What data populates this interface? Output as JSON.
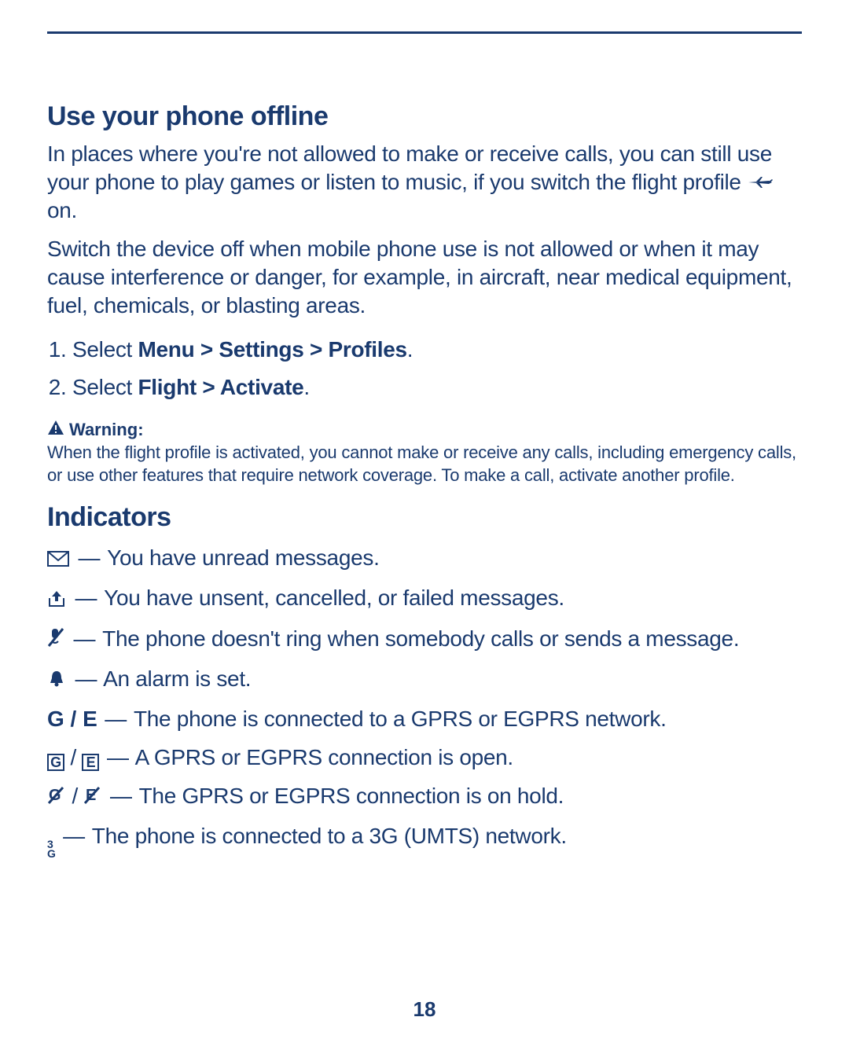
{
  "section1": {
    "heading": "Use your phone offline",
    "para1_a": "In places where you're not allowed to make or receive calls, you can still use your phone to play games or listen to music, if you switch the flight profile ",
    "para1_b": " on.",
    "para2": "Switch the device off when mobile phone use is not allowed or when it may cause interference or danger, for example, in aircraft, near medical equipment, fuel, chemicals, or blasting areas.",
    "steps": {
      "s1_a": "Select ",
      "s1_b": "Menu > Settings > Profiles",
      "s1_c": ".",
      "s2_a": "Select ",
      "s2_b": "Flight > Activate",
      "s2_c": "."
    },
    "warning_label": "Warning",
    "warning_body": "When the flight profile is activated, you cannot make or receive any calls, including emergency calls, or use other features that require network coverage. To make a call, activate another profile."
  },
  "section2": {
    "heading": "Indicators",
    "items": {
      "unread": {
        "text": "You have unread messages."
      },
      "unsent": {
        "text": "You have unsent, cancelled, or failed messages."
      },
      "silent": {
        "text": "The phone doesn't ring when somebody calls or sends a message."
      },
      "alarm": {
        "text": "An alarm is set."
      },
      "ge_net": {
        "g": "G",
        "slash": " / ",
        "e": "E",
        "text": "The phone is connected to a GPRS or EGPRS network."
      },
      "ge_open": {
        "g": "G",
        "slash": " / ",
        "e": "E",
        "text": "A GPRS or EGPRS connection is open."
      },
      "ge_hold": {
        "text": "The GPRS or EGPRS connection is on hold."
      },
      "umts": {
        "top": "3",
        "bot": "G",
        "text": "The phone is connected to a 3G (UMTS) network."
      }
    }
  },
  "dash": "—",
  "page_number": "18",
  "colors": {
    "ink": "#1a3a6e"
  }
}
